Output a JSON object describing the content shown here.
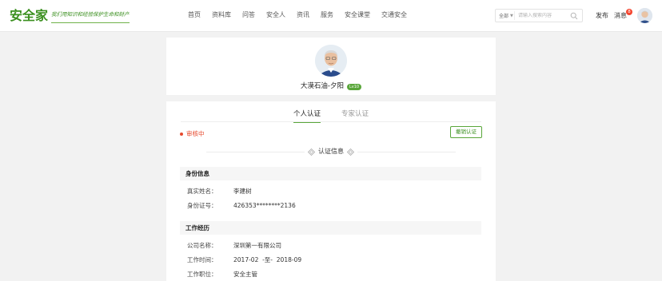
{
  "header": {
    "logo_text": "安全家",
    "slogan": "我们用知识和经验保护生命和财产",
    "nav": [
      "首页",
      "资料库",
      "问答",
      "安全人",
      "资讯",
      "服务",
      "安全课堂",
      "交通安全"
    ],
    "search": {
      "scope": "全部",
      "placeholder": "请输入搜索内容"
    },
    "publish_label": "发布",
    "messages_label": "消息",
    "messages_count": "8"
  },
  "profile": {
    "name": "大漠石油-夕阳",
    "level": "Lv10"
  },
  "certification": {
    "tabs": [
      "个人认证",
      "专家认证"
    ],
    "active_tab": 0,
    "status": "审核中",
    "withdraw_label": "撤销认证",
    "section_title": "认证信息",
    "identity": {
      "title": "身份信息",
      "rows": [
        {
          "label": "真实姓名：",
          "value": "李建树"
        },
        {
          "label": "身份证号：",
          "value": "426353********2136"
        }
      ]
    },
    "work": {
      "title": "工作经历",
      "rows": [
        {
          "label": "公司名称：",
          "value": "深圳第一有限公司"
        },
        {
          "label": "工作时间：",
          "value": "2017-02  -至-  2018-09"
        },
        {
          "label": "工作职位：",
          "value": "安全主管"
        }
      ]
    }
  },
  "colors": {
    "brand_green": "#3a8f1e",
    "accent_green": "#59a63a",
    "status_red": "#e6492d",
    "badge_red": "#f4452f"
  }
}
